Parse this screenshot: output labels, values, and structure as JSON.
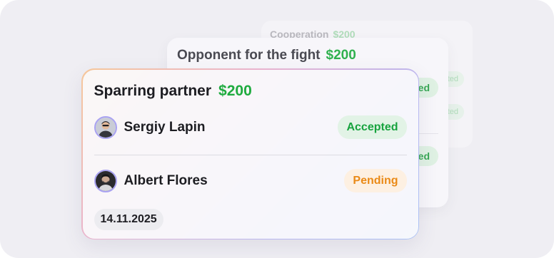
{
  "cards": {
    "back": {
      "title": "Cooperation",
      "price": "$200",
      "badges": [
        "Accepted",
        "Accepted"
      ]
    },
    "middle": {
      "title": "Opponent for the fight",
      "price": "$200",
      "badges": [
        "Accepted",
        "Accepted"
      ]
    },
    "front": {
      "title": "Sparring partner",
      "price": "$200",
      "participants": [
        {
          "name": "Sergiy Lapin",
          "status": "Accepted"
        },
        {
          "name": "Albert Flores",
          "status": "Pending"
        }
      ],
      "date": "14.11.2025"
    }
  },
  "colors": {
    "background": "#efeef3",
    "price_green": "#1fab3f",
    "accepted_bg": "#e2f3e6",
    "accepted_text": "#17a33e",
    "pending_bg": "#fdf0e2",
    "pending_text": "#ea8a17",
    "avatar_ring": "#a9a2f2"
  }
}
